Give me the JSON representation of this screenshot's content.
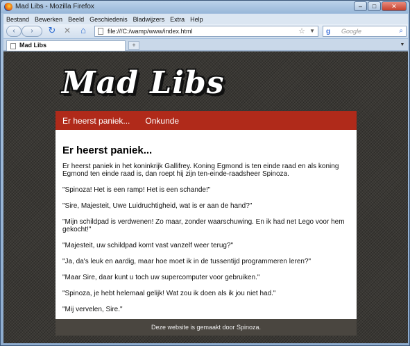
{
  "window": {
    "title": "Mad Libs - Mozilla Firefox",
    "minimize": "–",
    "maximize": "□",
    "close": "✕"
  },
  "menu": [
    "Bestand",
    "Bewerken",
    "Beeld",
    "Geschiedenis",
    "Bladwijzers",
    "Extra",
    "Help"
  ],
  "nav": {
    "back": "‹",
    "forward": "›",
    "reload": "↻",
    "stop": "✕",
    "home": "⌂",
    "url": "file:///C:/wamp/www/index.html",
    "star": "☆",
    "search_placeholder": "Google",
    "search_engine_glyph": "g",
    "search_glyph": "⌕"
  },
  "tab": {
    "title": "Mad Libs",
    "new_tab": "+"
  },
  "site": {
    "logo": "Mad Libs",
    "nav": [
      "Er heerst paniek...",
      "Onkunde"
    ],
    "heading": "Er heerst paniek...",
    "paragraphs": [
      "Er heerst paniek in het koninkrijk Gallifrey. Koning Egmond is ten einde raad en als koning Egmond ten einde raad is, dan roept hij zijn ten-einde-raadsheer Spinoza.",
      "\"Spinoza! Het is een ramp! Het is een schande!\"",
      "\"Sire, Majesteit, Uwe Luidruchtigheid, wat is er aan de hand?\"",
      "\"Mijn schildpad is verdwenen! Zo maar, zonder waarschuwing. En ik had net Lego voor hem gekocht!\"",
      "\"Majesteit, uw schildpad komt vast vanzelf weer terug?\"",
      "\"Ja, da's leuk en aardig, maar hoe moet ik in de tussentijd programmeren leren?\"",
      "\"Maar Sire, daar kunt u toch uw supercomputer voor gebruiken.\"",
      "\"Spinoza, je hebt helemaal gelijk! Wat zou ik doen als ik jou niet had.\"",
      "\"Mij vervelen, Sire.\""
    ],
    "footer": "Deze website is gemaakt door Spinoza."
  },
  "icons": {
    "app": "firefox-icon",
    "page": "page-icon"
  }
}
